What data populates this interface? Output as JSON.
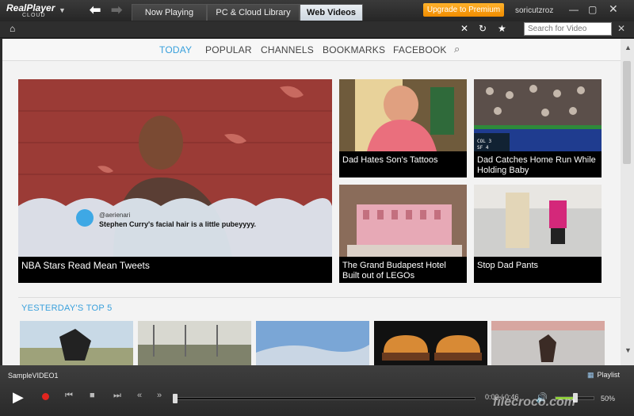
{
  "app": {
    "logo_main": "RealPlayer",
    "logo_sub": "CLOUD",
    "upgrade_label": "Upgrade to Premium",
    "username": "soricutzroz"
  },
  "tabs": [
    {
      "label": "Now Playing",
      "active": false
    },
    {
      "label": "PC & Cloud Library",
      "active": false
    },
    {
      "label": "Web Videos",
      "active": true
    }
  ],
  "toolbar": {
    "search_placeholder": "Search for Video"
  },
  "categories": [
    {
      "label": "TODAY",
      "active": true
    },
    {
      "label": "POPULAR",
      "active": false
    },
    {
      "label": "CHANNELS",
      "active": false
    },
    {
      "label": "BOOKMARKS",
      "active": false
    },
    {
      "label": "FACEBOOK",
      "active": false
    }
  ],
  "featured": {
    "caption": "NBA Stars Read Mean Tweets",
    "tweet_handle": "@aerienari",
    "tweet_text": "Stephen Curry's facial hair is a little pubeyyyy."
  },
  "videos": [
    {
      "caption_line1": "Dad Hates Son's Tattoos",
      "caption_line2": ""
    },
    {
      "caption_line1": "Dad Catches Home Run While",
      "caption_line2": "Holding Baby"
    },
    {
      "caption_line1": "The Grand Budapest Hotel",
      "caption_line2": "Built out of LEGOs"
    },
    {
      "caption_line1": "Stop Dad Pants",
      "caption_line2": ""
    }
  ],
  "yesterday": {
    "title": "YESTERDAY'S TOP 5"
  },
  "player": {
    "now_playing": "SampleVIDEO1",
    "playlist_label": "Playlist",
    "time": "0:00 / 0:46",
    "volume_label": "50%",
    "volume": 0.5,
    "progress": 0.0
  },
  "watermark": "filecroco.com",
  "colors": {
    "accent_blue": "#39a0dc",
    "upgrade_orange": "#f49a0e",
    "volume_green": "#8fcf3a"
  }
}
